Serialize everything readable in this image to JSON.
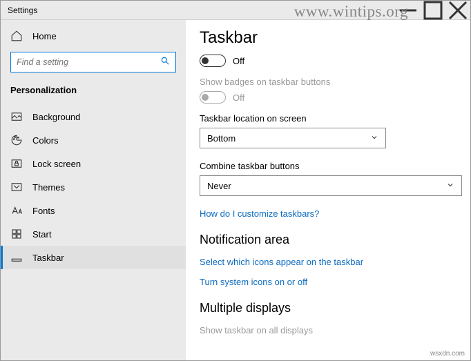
{
  "window": {
    "title": "Settings"
  },
  "sidebar": {
    "home": "Home",
    "search_placeholder": "Find a setting",
    "category": "Personalization",
    "items": [
      {
        "label": "Background"
      },
      {
        "label": "Colors"
      },
      {
        "label": "Lock screen"
      },
      {
        "label": "Themes"
      },
      {
        "label": "Fonts"
      },
      {
        "label": "Start"
      },
      {
        "label": "Taskbar"
      }
    ]
  },
  "main": {
    "title": "Taskbar",
    "toggle1": {
      "state": "Off"
    },
    "badges": {
      "label": "Show badges on taskbar buttons",
      "state": "Off"
    },
    "location": {
      "label": "Taskbar location on screen",
      "value": "Bottom"
    },
    "combine": {
      "label": "Combine taskbar buttons",
      "value": "Never"
    },
    "link_customize": "How do I customize taskbars?",
    "section_notif": "Notification area",
    "link_icons": "Select which icons appear on the taskbar",
    "link_system": "Turn system icons on or off",
    "section_multi": "Multiple displays",
    "multi_label": "Show taskbar on all displays"
  },
  "watermark": "www.wintips.org",
  "source_tag": "wsxdn.com"
}
